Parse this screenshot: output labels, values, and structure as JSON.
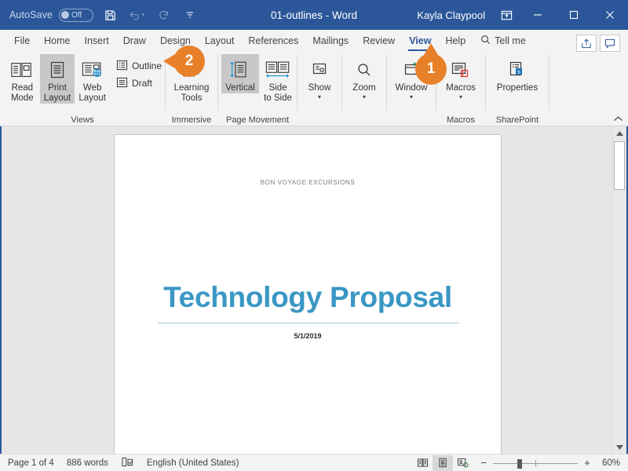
{
  "titlebar": {
    "autosave_label": "AutoSave",
    "autosave_state": "Off",
    "save_icon": "save-icon",
    "undo_icon": "undo-icon",
    "redo_icon": "redo-icon",
    "customize_icon": "customize-quick-access-icon",
    "document_title": "01-outlines - Word",
    "user_name": "Kayla Claypool",
    "ribbon_display_icon": "ribbon-display-options-icon",
    "minimize_icon": "minimize-icon",
    "maximize_icon": "maximize-icon",
    "close_icon": "close-icon",
    "bg_color": "#2b579a"
  },
  "tabs": [
    {
      "label": "File",
      "active": false
    },
    {
      "label": "Home",
      "active": false
    },
    {
      "label": "Insert",
      "active": false
    },
    {
      "label": "Draw",
      "active": false
    },
    {
      "label": "Design",
      "active": false
    },
    {
      "label": "Layout",
      "active": false
    },
    {
      "label": "References",
      "active": false
    },
    {
      "label": "Mailings",
      "active": false
    },
    {
      "label": "Review",
      "active": false
    },
    {
      "label": "View",
      "active": true
    },
    {
      "label": "Help",
      "active": false
    }
  ],
  "tellme": {
    "label": "Tell me",
    "icon": "search-icon"
  },
  "tabbar_right": {
    "share_icon": "share-icon",
    "comments_icon": "comments-icon"
  },
  "ribbon": {
    "accent_color": "#2b579a",
    "groups": [
      {
        "label": "Views",
        "big_buttons": [
          {
            "label_line1": "Read",
            "label_line2": "Mode",
            "icon": "read-mode-icon",
            "selected": false
          },
          {
            "label_line1": "Print",
            "label_line2": "Layout",
            "icon": "print-layout-icon",
            "selected": true
          },
          {
            "label_line1": "Web",
            "label_line2": "Layout",
            "icon": "web-layout-icon",
            "selected": false
          }
        ],
        "small_buttons": [
          {
            "label": "Outline",
            "icon": "outline-view-icon"
          },
          {
            "label": "Draft",
            "icon": "draft-view-icon"
          }
        ]
      },
      {
        "label": "Immersive",
        "big_buttons": [
          {
            "label_line1": "Learning",
            "label_line2": "Tools",
            "icon": "learning-tools-icon",
            "selected": false
          }
        ]
      },
      {
        "label": "Page Movement",
        "big_buttons": [
          {
            "label_line1": "Vertical",
            "label_line2": "",
            "icon": "vertical-page-movement-icon",
            "selected": true
          },
          {
            "label_line1": "Side",
            "label_line2": "to Side",
            "icon": "side-to-side-icon",
            "selected": false
          }
        ]
      },
      {
        "label": "",
        "big_buttons": [
          {
            "label_line1": "Show",
            "label_line2": "",
            "icon": "show-icon",
            "selected": false,
            "dropdown": true
          }
        ]
      },
      {
        "label": "",
        "big_buttons": [
          {
            "label_line1": "Zoom",
            "label_line2": "",
            "icon": "zoom-icon",
            "selected": false,
            "dropdown": true
          }
        ]
      },
      {
        "label": "",
        "big_buttons": [
          {
            "label_line1": "Window",
            "label_line2": "",
            "icon": "new-window-icon",
            "selected": false,
            "dropdown": true
          }
        ]
      },
      {
        "label": "Macros",
        "big_buttons": [
          {
            "label_line1": "Macros",
            "label_line2": "",
            "icon": "macros-icon",
            "selected": false,
            "dropdown": true
          }
        ]
      },
      {
        "label": "SharePoint",
        "big_buttons": [
          {
            "label_line1": "Properties",
            "label_line2": "",
            "icon": "properties-icon",
            "selected": false
          }
        ]
      }
    ],
    "collapse_icon": "collapse-ribbon-icon"
  },
  "callouts": [
    {
      "number": "1",
      "target": "view-tab",
      "direction": "up",
      "color": "#e8802a"
    },
    {
      "number": "2",
      "target": "outline-button",
      "direction": "left",
      "color": "#e8802a"
    }
  ],
  "document": {
    "header_text": "BON VOYAGE EXCURSIONS",
    "title": "Technology Proposal",
    "title_color": "#3a97c4",
    "date": "5/1/2019"
  },
  "scrollbar": {
    "up_icon": "scroll-up-icon",
    "down_icon": "scroll-down-icon"
  },
  "statusbar": {
    "page_info": "Page 1 of 4",
    "word_count": "886 words",
    "proofing_icon": "proofing-errors-icon",
    "language": "English (United States)",
    "view_buttons": [
      {
        "icon": "read-mode-view-icon",
        "selected": false
      },
      {
        "icon": "print-layout-view-icon",
        "selected": true
      },
      {
        "icon": "web-layout-view-icon",
        "selected": false
      }
    ],
    "zoom_out": "−",
    "zoom_in": "+",
    "zoom_level": "60%"
  }
}
